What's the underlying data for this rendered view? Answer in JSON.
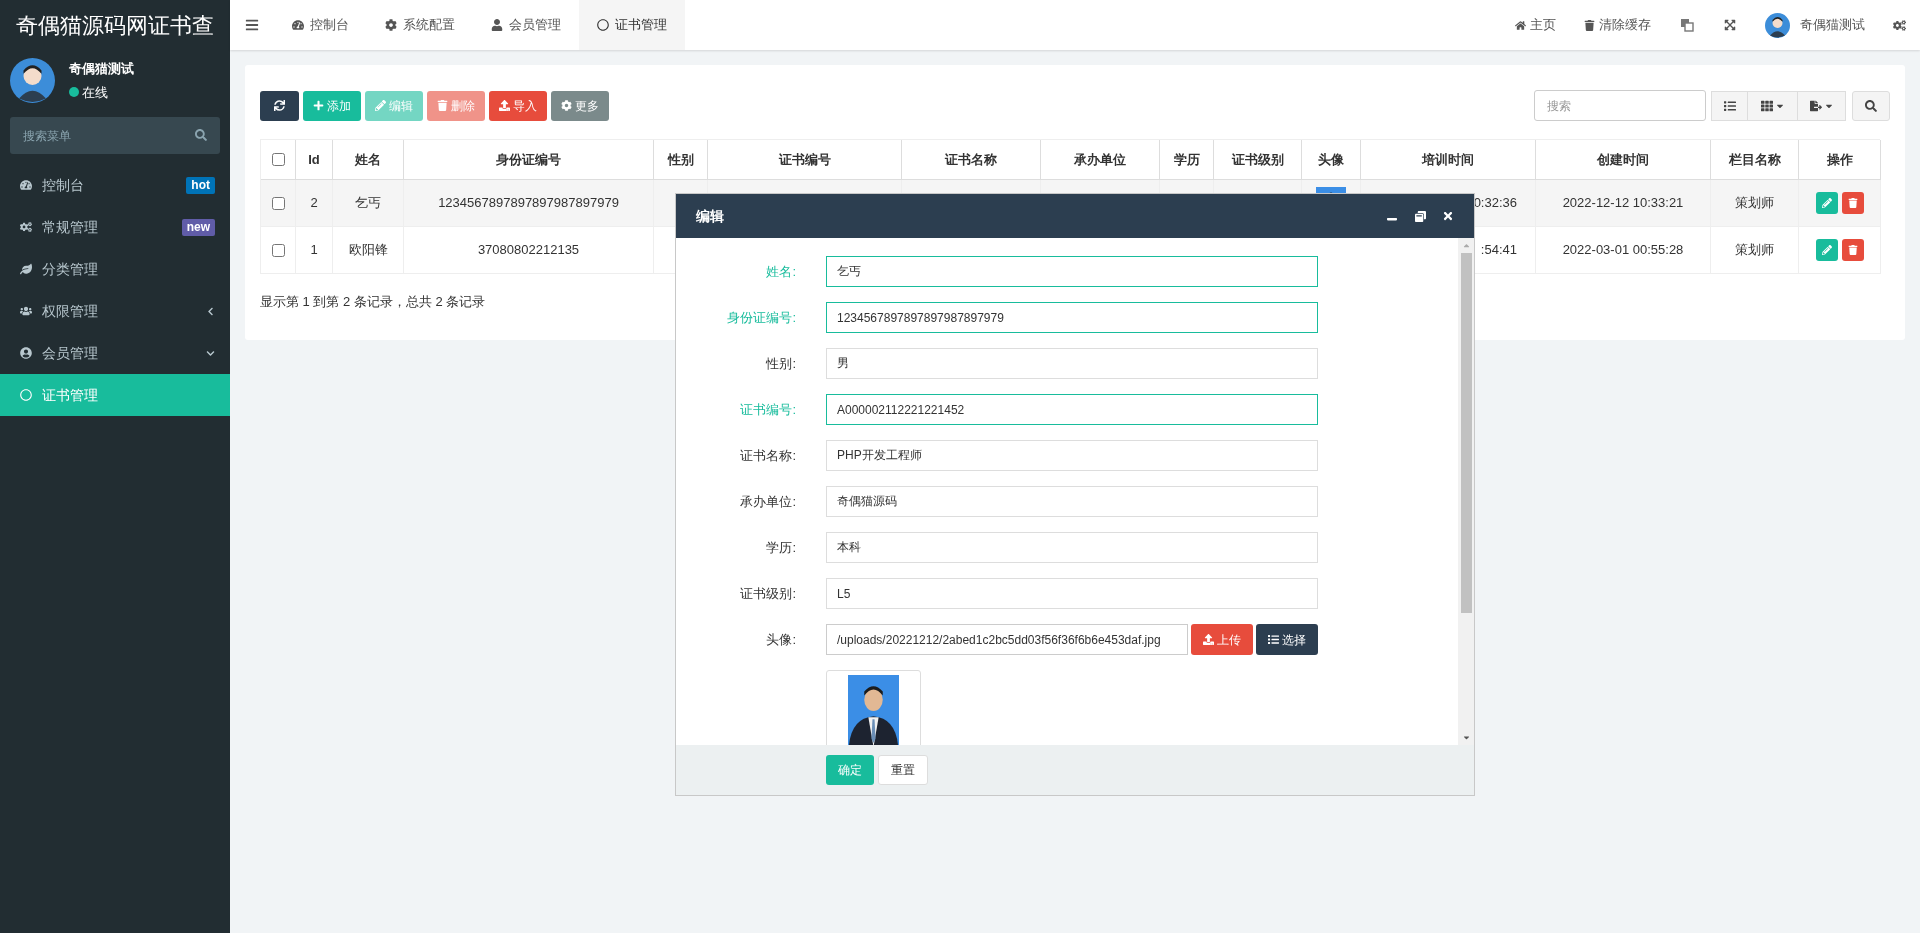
{
  "sidebar": {
    "logo": "奇偶猫源码网证书查",
    "user": {
      "name": "奇偶猫测试",
      "status": "在线"
    },
    "search": {
      "placeholder": "搜索菜单"
    },
    "items": [
      {
        "label": "控制台",
        "badge": {
          "text": "hot",
          "color": "#0073b7"
        },
        "selected": false
      },
      {
        "label": "常规管理",
        "badge": {
          "text": "new",
          "color": "#605ca8"
        },
        "selected": false
      },
      {
        "label": "分类管理",
        "selected": false
      },
      {
        "label": "权限管理",
        "expanded": false,
        "selected": false
      },
      {
        "label": "会员管理",
        "expanded": true,
        "selected": false
      },
      {
        "label": "证书管理",
        "selected": true
      }
    ]
  },
  "topbar": {
    "tabs": [
      {
        "label": "控制台",
        "selected": false
      },
      {
        "label": "系统配置",
        "selected": false
      },
      {
        "label": "会员管理",
        "selected": false
      },
      {
        "label": "证书管理",
        "selected": true
      }
    ],
    "links": [
      "主页",
      "清除缓存"
    ],
    "user": "奇偶猫测试"
  },
  "toolbar": {
    "buttons": [
      {
        "kind": "primary",
        "disabled": false
      },
      {
        "kind": "success",
        "label": "添加",
        "disabled": false
      },
      {
        "kind": "success",
        "label": "编辑",
        "disabled": true
      },
      {
        "kind": "danger",
        "label": "删除",
        "disabled": true
      },
      {
        "kind": "danger",
        "label": "导入",
        "disabled": false
      },
      {
        "kind": "info",
        "label": "更多",
        "disabled": false
      }
    ],
    "search": {
      "placeholder": "搜索"
    }
  },
  "table": {
    "select_all": {
      "checked": false
    },
    "columns": [
      "Id",
      "姓名",
      "身份证编号",
      "性别",
      "证书编号",
      "证书名称",
      "承办单位",
      "学历",
      "证书级别",
      "头像",
      "培训时间",
      "创建时间",
      "栏目名称",
      "操作"
    ],
    "rows": [
      {
        "checked": false,
        "cells": [
          "2",
          "乞丐",
          "1234567897897897987897979",
          null,
          null,
          null,
          null,
          null,
          null,
          {
            "kind": "picture"
          },
          {
            "text": "0:32:36",
            "clipped": true
          },
          "2022-12-12 10:33:21",
          "策划师"
        ]
      },
      {
        "checked": false,
        "cells": [
          "1",
          "欧阳锋",
          "37080802212135",
          null,
          null,
          null,
          null,
          null,
          null,
          null,
          {
            "text": ":54:41",
            "clipped": true
          },
          "2022-03-01 00:55:28",
          "策划师"
        ]
      }
    ],
    "summary": "显示第 1 到第 2 条记录，总共 2 条记录"
  },
  "dialog": {
    "title": "编辑",
    "fields": [
      {
        "kind": "text",
        "label": "姓名:",
        "value": "乞丐",
        "valid": true
      },
      {
        "kind": "text",
        "label": "身份证编号:",
        "value": "1234567897897897987897979",
        "valid": true
      },
      {
        "kind": "text",
        "label": "性别:",
        "value": "男",
        "valid": false
      },
      {
        "kind": "text",
        "label": "证书编号:",
        "value": "A000002112221221452",
        "valid": true
      },
      {
        "kind": "text",
        "label": "证书名称:",
        "value": "PHP开发工程师",
        "valid": false
      },
      {
        "kind": "text",
        "label": "承办单位:",
        "value": "奇偶猫源码",
        "valid": false
      },
      {
        "kind": "text",
        "label": "学历:",
        "value": "本科",
        "valid": false
      },
      {
        "kind": "text",
        "label": "证书级别:",
        "value": "L5",
        "valid": false
      },
      {
        "kind": "file",
        "label": "头像:",
        "value": "/uploads/20221212/2abed1c2bc5dd03f56f36f6b6e453daf.jpg",
        "valid": false,
        "buttons": [
          "上传",
          "选择"
        ],
        "preview": {
          "kind": "picture"
        }
      }
    ],
    "buttons": [
      "确定",
      "重置"
    ]
  }
}
